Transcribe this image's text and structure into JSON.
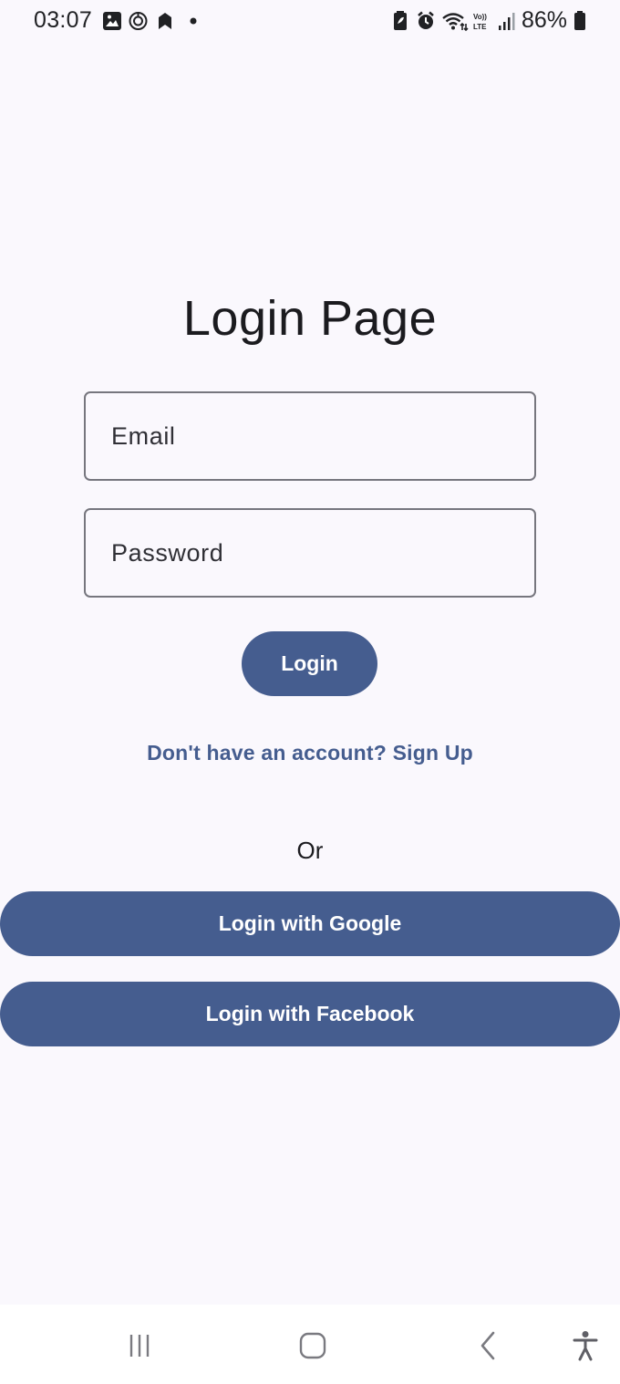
{
  "status_bar": {
    "time": "03:07",
    "battery": "86%",
    "icons": [
      "gallery-icon",
      "sync-icon",
      "bookmark-icon",
      "dot-icon",
      "battery-saver-icon",
      "alarm-icon",
      "wifi-icon",
      "volte-icon",
      "signal-icon",
      "battery-icon"
    ]
  },
  "login": {
    "title": "Login Page",
    "email_placeholder": "Email",
    "password_placeholder": "Password",
    "login_label": "Login",
    "signup_link": "Don't have an account? Sign Up",
    "or_label": "Or",
    "google_label": "Login with Google",
    "facebook_label": "Login with Facebook"
  },
  "nav_bar": {
    "icons": [
      "recents-icon",
      "home-icon",
      "back-icon",
      "accessibility-icon"
    ]
  },
  "colors": {
    "background": "#faf8fd",
    "primary": "#455d8f",
    "on_primary": "#ffffff",
    "outline": "#76767e"
  }
}
